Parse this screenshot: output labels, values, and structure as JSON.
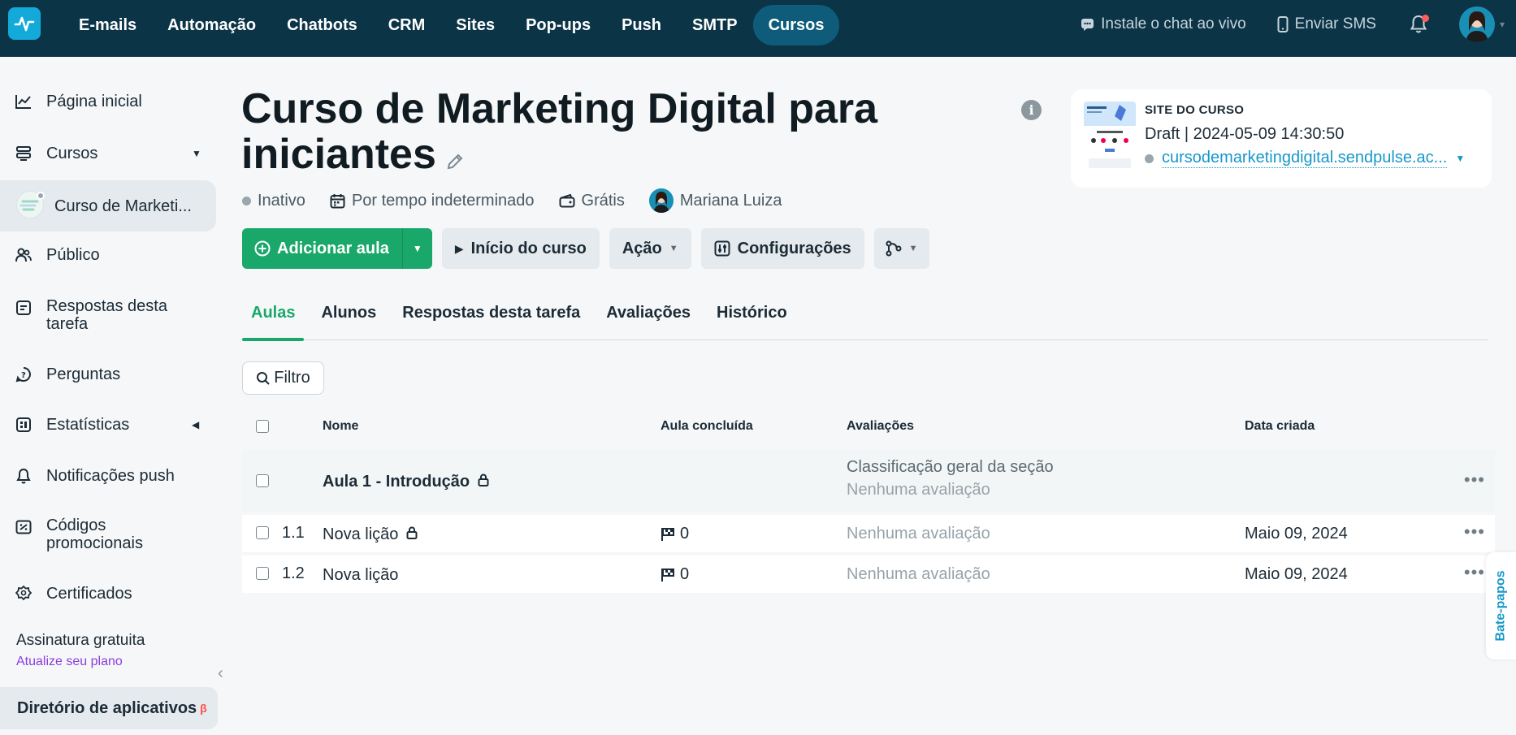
{
  "nav": {
    "items": [
      "E-mails",
      "Automação",
      "Chatbots",
      "CRM",
      "Sites",
      "Pop-ups",
      "Push",
      "SMTP",
      "Cursos"
    ],
    "active": "Cursos",
    "live_chat": "Instale o chat ao vivo",
    "sms": "Enviar SMS"
  },
  "sidebar": {
    "home": "Página inicial",
    "courses": "Cursos",
    "current_course": "Curso de Marketi...",
    "audience": "Público",
    "task_answers": "Respostas desta tarefa",
    "questions": "Perguntas",
    "stats": "Estatísticas",
    "push": "Notificações push",
    "promo": "Códigos promocionais",
    "certificates": "Certificados",
    "plan_title": "Assinatura gratuita",
    "plan_link": "Atualize seu plano",
    "app_dir": "Diretório de aplicativos",
    "app_dir_badge": "β"
  },
  "course": {
    "title": "Curso de Marketing Digital para iniciantes",
    "status": "Inativo",
    "duration": "Por tempo indeterminado",
    "price": "Grátis",
    "author": "Mariana Luiza"
  },
  "site_card": {
    "label": "SITE DO CURSO",
    "status": "Draft | 2024-05-09 14:30:50",
    "url": "cursodemarketingdigital.sendpulse.ac..."
  },
  "actions": {
    "add_lesson": "Adicionar aula",
    "start_course": "Início do curso",
    "action": "Ação",
    "settings": "Configurações"
  },
  "tabs": [
    "Aulas",
    "Alunos",
    "Respostas desta tarefa",
    "Avaliações",
    "Histórico"
  ],
  "filter": "Filtro",
  "table": {
    "headers": {
      "name": "Nome",
      "done": "Aula concluída",
      "ratings": "Avaliações",
      "created": "Data criada"
    },
    "section": {
      "name": "Aula 1 - Introdução",
      "rating_title": "Classificação geral da seção",
      "rating_value": "Nenhuma avaliação"
    },
    "lessons": [
      {
        "num": "1.1",
        "name": "Nova lição",
        "done": "0",
        "rating": "Nenhuma avaliação",
        "date": "Maio 09, 2024"
      },
      {
        "num": "1.2",
        "name": "Nova lição",
        "done": "0",
        "rating": "Nenhuma avaliação",
        "date": "Maio 09, 2024"
      }
    ]
  },
  "chat_tab": "Bate-papos"
}
